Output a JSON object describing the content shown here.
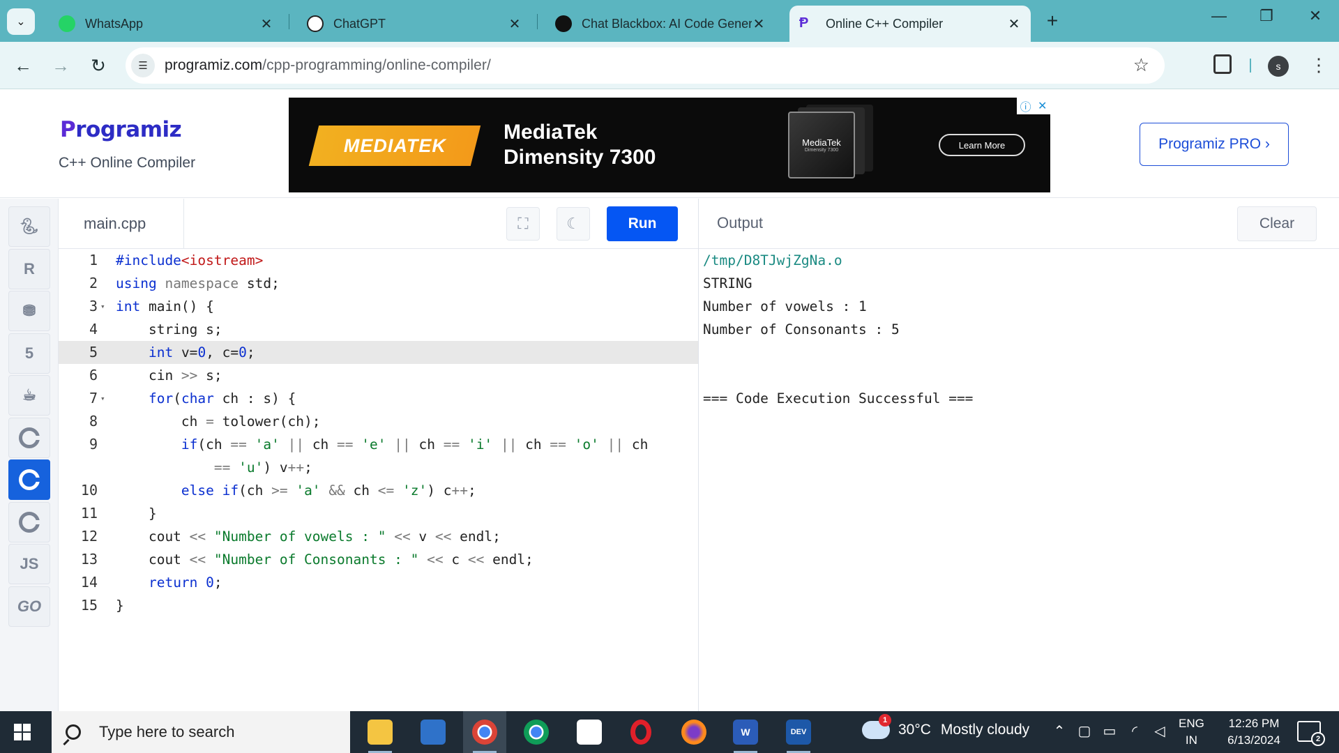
{
  "browser": {
    "tabs": [
      {
        "label": "WhatsApp",
        "icon": "whatsapp-icon",
        "color": "#25d366"
      },
      {
        "label": "ChatGPT",
        "icon": "chatgpt-icon",
        "color": "#ffffff"
      },
      {
        "label": "Chat Blackbox: AI Code Generat",
        "icon": "blackbox-icon",
        "color": "#111111"
      },
      {
        "label": "Online C++ Compiler",
        "icon": "programiz-icon",
        "color": "#5b2bd6",
        "active": true
      }
    ],
    "url_host": "programiz.com",
    "url_path": "/cpp-programming/online-compiler/",
    "profile_initial": "s"
  },
  "site": {
    "logo_first": "P",
    "logo_rest": "rogramiz",
    "subtitle": "C++ Online Compiler",
    "pro_button": "Programiz PRO ›"
  },
  "ad": {
    "brand_badge": "MEDIATEK",
    "title_line1": "MediaTek",
    "title_line2": "Dimensity 7300",
    "chip_label": "MediaTek",
    "chip_sub": "Dimensity 7300",
    "cta": "Learn More"
  },
  "rail": {
    "items": [
      "python",
      "r",
      "sql",
      "html",
      "java",
      "c",
      "cpp",
      "csharp",
      "js",
      "go"
    ],
    "active": "cpp",
    "js_label": "JS",
    "go_label": "GO"
  },
  "editor": {
    "filename": "main.cpp",
    "run_label": "Run",
    "highlighted_line": 5,
    "code_lines": [
      "#include<iostream>",
      "using namespace std;",
      "int main() {",
      "    string s;",
      "    int v=0, c=0;",
      "    cin >> s;",
      "    for(char ch : s) {",
      "        ch = tolower(ch);",
      "        if(ch == 'a' || ch == 'e' || ch == 'i' || ch == 'o' || ch == 'u') v++;",
      "        else if(ch >= 'a' && ch <= 'z') c++;",
      "    }",
      "    cout << \"Number of vowels : \" << v << endl;",
      "    cout << \"Number of Consonants : \" << c << endl;",
      "    return 0;",
      "}"
    ],
    "line_numbers": [
      "1",
      "2",
      "3",
      "4",
      "5",
      "6",
      "7",
      "8",
      "9",
      "10",
      "11",
      "12",
      "13",
      "14",
      "15"
    ]
  },
  "output": {
    "title": "Output",
    "clear_label": "Clear",
    "lines": [
      "/tmp/D8TJwjZgNa.o",
      "STRING",
      "Number of vowels : 1",
      "Number of Consonants : 5",
      "",
      "",
      "=== Code Execution Successful ==="
    ]
  },
  "taskbar": {
    "search_placeholder": "Type here to search",
    "weather_temp": "30°C",
    "weather_text": "Mostly cloudy",
    "weather_badge": "1",
    "lang_top": "ENG",
    "lang_bottom": "IN",
    "time": "12:26 PM",
    "date": "6/13/2024",
    "notification_count": "2"
  },
  "colors": {
    "tabstrip": "#5bb5c0",
    "run_button": "#0556f3",
    "active_rail": "#1662dd",
    "keyword": "#0a2fd0",
    "string": "#0a7a2c",
    "taskbar": "#1f2b36"
  }
}
